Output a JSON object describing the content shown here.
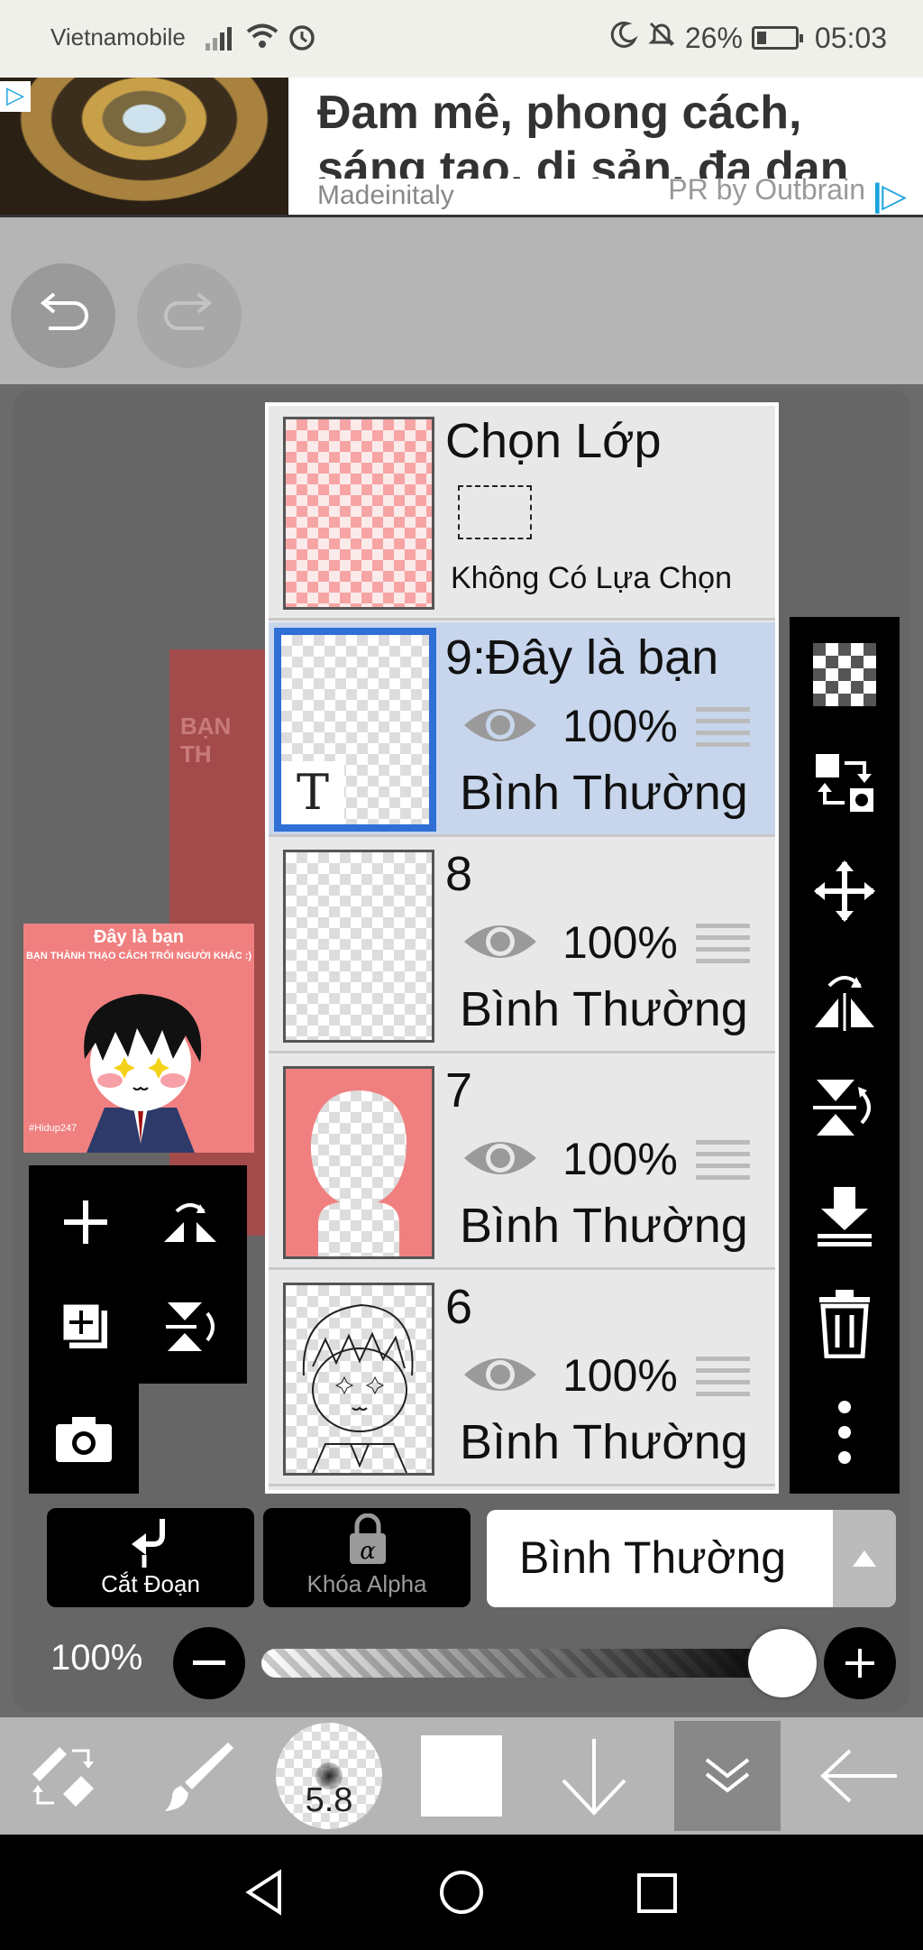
{
  "status_bar": {
    "carrier": "Vietnamobile",
    "battery": "26%",
    "time": "05:03"
  },
  "ad": {
    "title": "Đam mê, phong cách, sáng tạo, di sản, đa dạn",
    "brand": "Madeinitaly",
    "sponsor": "PR by Outbrain"
  },
  "canvas": {
    "peek_text": "BẠN TH",
    "thumb_title": "Đây là bạn",
    "thumb_subtitle": "BẠN THÀNH THẠO CÁCH TRỐI NGƯỜI KHÁC :)",
    "thumb_watermark": "#Hidup247"
  },
  "selection_layer": {
    "title": "Chọn Lớp",
    "status": "Không Có Lựa Chọn"
  },
  "layers": [
    {
      "name": "9:Đây là bạn",
      "opacity": "100%",
      "blend": "Bình Thường",
      "selected": true
    },
    {
      "name": "8",
      "opacity": "100%",
      "blend": "Bình Thường",
      "selected": false
    },
    {
      "name": "7",
      "opacity": "100%",
      "blend": "Bình Thường",
      "selected": false
    },
    {
      "name": "6",
      "opacity": "100%",
      "blend": "Bình Thường",
      "selected": false
    }
  ],
  "text_layer_badge": "T",
  "bottom": {
    "clip_label": "Cắt Đoạn",
    "alpha_lock_label": "Khóa Alpha",
    "blend_mode": "Bình Thường",
    "opacity": "100%",
    "opacity_value": 1.0
  },
  "toolbar": {
    "brush_size": "5.8"
  }
}
